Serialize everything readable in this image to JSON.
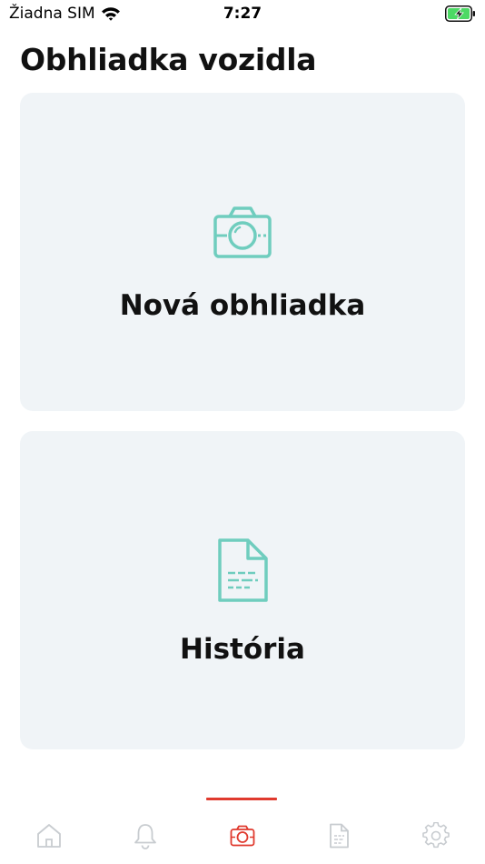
{
  "status_bar": {
    "carrier": "Žiadna SIM",
    "time": "7:27",
    "icons": [
      "wifi-icon",
      "battery-charging-icon"
    ]
  },
  "page": {
    "title": "Obhliadka vozidla"
  },
  "cards": [
    {
      "label": "Nová obhliadka",
      "icon": "camera-icon"
    },
    {
      "label": "História",
      "icon": "document-icon"
    }
  ],
  "tab_bar": {
    "items": [
      {
        "icon": "home-icon",
        "active": false
      },
      {
        "icon": "bell-icon",
        "active": false
      },
      {
        "icon": "camera-icon",
        "active": true
      },
      {
        "icon": "document-icon",
        "active": false
      },
      {
        "icon": "gear-icon",
        "active": false
      }
    ],
    "active_index": 2
  },
  "colors": {
    "accent_teal": "#6fcdbe",
    "active_tab_red": "#e03a2e",
    "inactive_icon": "#c8ccd0",
    "card_bg": "#f0f4f7",
    "battery_green": "#4cd964"
  }
}
